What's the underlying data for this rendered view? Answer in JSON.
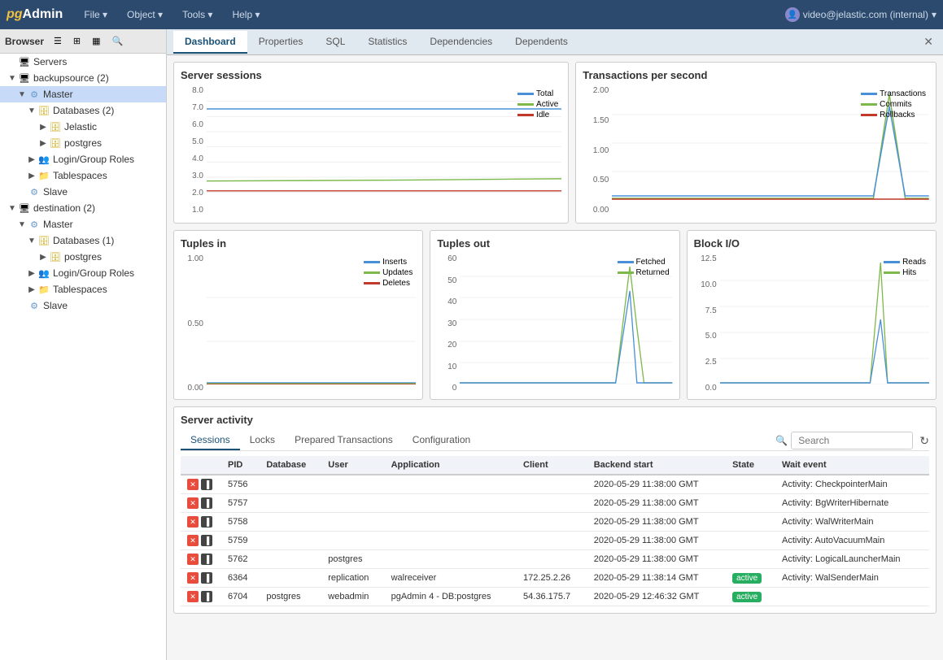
{
  "app": {
    "logo_pg": "pg",
    "logo_admin": "Admin",
    "user": "video@jelastic.com (internal)"
  },
  "topbar_nav": [
    {
      "label": "File ▾",
      "id": "file"
    },
    {
      "label": "Object ▾",
      "id": "object"
    },
    {
      "label": "Tools ▾",
      "id": "tools"
    },
    {
      "label": "Help ▾",
      "id": "help"
    }
  ],
  "sidebar": {
    "title": "Browser",
    "tree": [
      {
        "id": "servers",
        "label": "Servers",
        "depth": 0,
        "icon": "🖥",
        "toggle": "",
        "type": "server"
      },
      {
        "id": "backupsource",
        "label": "backupsource (2)",
        "depth": 0,
        "icon": "🖥",
        "toggle": "▼",
        "type": "server"
      },
      {
        "id": "master1",
        "label": "Master",
        "depth": 1,
        "icon": "⚙",
        "toggle": "▼",
        "type": "master",
        "selected": true
      },
      {
        "id": "databases1",
        "label": "Databases (2)",
        "depth": 2,
        "icon": "🗄",
        "toggle": "▼",
        "type": "db-group"
      },
      {
        "id": "jelastic",
        "label": "Jelastic",
        "depth": 3,
        "icon": "🗄",
        "toggle": "▶",
        "type": "db"
      },
      {
        "id": "postgres1",
        "label": "postgres",
        "depth": 3,
        "icon": "🗄",
        "toggle": "▶",
        "type": "db"
      },
      {
        "id": "login1",
        "label": "Login/Group Roles",
        "depth": 2,
        "icon": "👥",
        "toggle": "▶",
        "type": "roles"
      },
      {
        "id": "tablespaces1",
        "label": "Tablespaces",
        "depth": 2,
        "icon": "📁",
        "toggle": "▶",
        "type": "ts"
      },
      {
        "id": "slave1",
        "label": "Slave",
        "depth": 1,
        "icon": "⚙",
        "toggle": "",
        "type": "slave"
      },
      {
        "id": "destination",
        "label": "destination (2)",
        "depth": 0,
        "icon": "🖥",
        "toggle": "▼",
        "type": "server"
      },
      {
        "id": "master2",
        "label": "Master",
        "depth": 1,
        "icon": "⚙",
        "toggle": "▼",
        "type": "master"
      },
      {
        "id": "databases2",
        "label": "Databases (1)",
        "depth": 2,
        "icon": "🗄",
        "toggle": "▼",
        "type": "db-group"
      },
      {
        "id": "postgres2",
        "label": "postgres",
        "depth": 3,
        "icon": "🗄",
        "toggle": "▶",
        "type": "db"
      },
      {
        "id": "login2",
        "label": "Login/Group Roles",
        "depth": 2,
        "icon": "👥",
        "toggle": "▶",
        "type": "roles"
      },
      {
        "id": "tablespaces2",
        "label": "Tablespaces",
        "depth": 2,
        "icon": "📁",
        "toggle": "▶",
        "type": "ts"
      },
      {
        "id": "slave2",
        "label": "Slave",
        "depth": 1,
        "icon": "⚙",
        "toggle": "",
        "type": "slave"
      }
    ]
  },
  "tabs": [
    {
      "label": "Dashboard",
      "active": true
    },
    {
      "label": "Properties",
      "active": false
    },
    {
      "label": "SQL",
      "active": false
    },
    {
      "label": "Statistics",
      "active": false
    },
    {
      "label": "Dependencies",
      "active": false
    },
    {
      "label": "Dependents",
      "active": false
    }
  ],
  "charts": {
    "server_sessions": {
      "title": "Server sessions",
      "legend": [
        {
          "label": "Total",
          "color": "#4a90d9"
        },
        {
          "label": "Active",
          "color": "#7db84a"
        },
        {
          "label": "Idle",
          "color": "#c0392b"
        }
      ],
      "y_labels": [
        "8.0",
        "7.0",
        "6.0",
        "5.0",
        "4.0",
        "3.0",
        "2.0",
        "1.0"
      ]
    },
    "transactions_per_second": {
      "title": "Transactions per second",
      "legend": [
        {
          "label": "Transactions",
          "color": "#4a90d9"
        },
        {
          "label": "Commits",
          "color": "#7db84a"
        },
        {
          "label": "Rollbacks",
          "color": "#c0392b"
        }
      ],
      "y_labels": [
        "2.00",
        "1.50",
        "1.00",
        "0.50",
        "0.00"
      ]
    },
    "tuples_in": {
      "title": "Tuples in",
      "legend": [
        {
          "label": "Inserts",
          "color": "#4a90d9"
        },
        {
          "label": "Updates",
          "color": "#7db84a"
        },
        {
          "label": "Deletes",
          "color": "#c0392b"
        }
      ],
      "y_labels": [
        "1.00",
        "0.50",
        "0.00"
      ]
    },
    "tuples_out": {
      "title": "Tuples out",
      "legend": [
        {
          "label": "Fetched",
          "color": "#4a90d9"
        },
        {
          "label": "Returned",
          "color": "#7db84a"
        }
      ],
      "y_labels": [
        "60",
        "50",
        "40",
        "30",
        "20",
        "10",
        "0"
      ]
    },
    "block_io": {
      "title": "Block I/O",
      "legend": [
        {
          "label": "Reads",
          "color": "#4a90d9"
        },
        {
          "label": "Hits",
          "color": "#7db84a"
        }
      ],
      "y_labels": [
        "12.5",
        "10.0",
        "7.5",
        "5.0",
        "2.5",
        "0.0"
      ]
    }
  },
  "server_activity": {
    "title": "Server activity",
    "tabs": [
      "Sessions",
      "Locks",
      "Prepared Transactions",
      "Configuration"
    ],
    "active_tab": "Sessions",
    "search_placeholder": "Search",
    "columns": [
      "PID",
      "Database",
      "User",
      "Application",
      "Client",
      "Backend start",
      "State",
      "Wait event"
    ],
    "rows": [
      {
        "pid": "5756",
        "database": "",
        "user": "",
        "application": "",
        "client": "",
        "backend_start": "2020-05-29 11:38:00 GMT",
        "state": "",
        "wait_event": "Activity: CheckpointerMain"
      },
      {
        "pid": "5757",
        "database": "",
        "user": "",
        "application": "",
        "client": "",
        "backend_start": "2020-05-29 11:38:00 GMT",
        "state": "",
        "wait_event": "Activity: BgWriterHibernate"
      },
      {
        "pid": "5758",
        "database": "",
        "user": "",
        "application": "",
        "client": "",
        "backend_start": "2020-05-29 11:38:00 GMT",
        "state": "",
        "wait_event": "Activity: WalWriterMain"
      },
      {
        "pid": "5759",
        "database": "",
        "user": "",
        "application": "",
        "client": "",
        "backend_start": "2020-05-29 11:38:00 GMT",
        "state": "",
        "wait_event": "Activity: AutoVacuumMain"
      },
      {
        "pid": "5762",
        "database": "",
        "user": "postgres",
        "application": "",
        "client": "",
        "backend_start": "2020-05-29 11:38:00 GMT",
        "state": "",
        "wait_event": "Activity: LogicalLauncherMain"
      },
      {
        "pid": "6364",
        "database": "",
        "user": "replication",
        "application": "walreceiver",
        "client": "172.25.2.26",
        "backend_start": "2020-05-29 11:38:14 GMT",
        "state": "active",
        "wait_event": "Activity: WalSenderMain"
      },
      {
        "pid": "6704",
        "database": "postgres",
        "user": "webadmin",
        "application": "pgAdmin 4 - DB:postgres",
        "client": "54.36.175.7",
        "backend_start": "2020-05-29 12:46:32 GMT",
        "state": "active",
        "wait_event": ""
      }
    ]
  }
}
